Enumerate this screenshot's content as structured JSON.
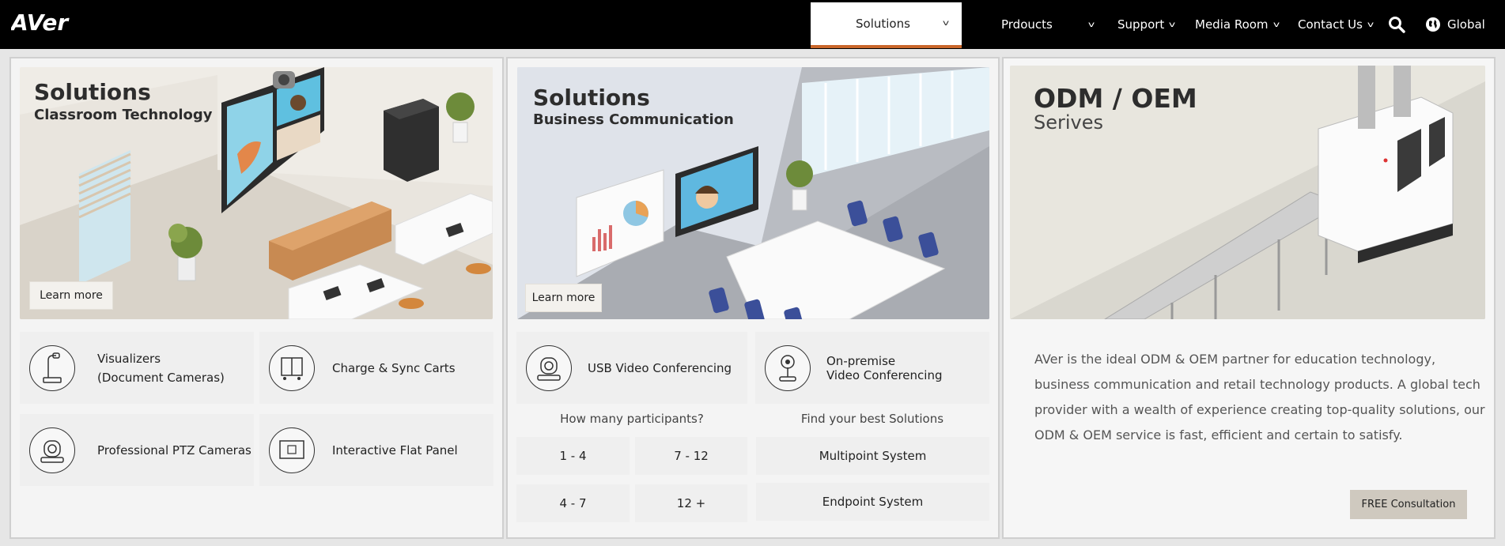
{
  "header": {
    "logo_text": "AVer",
    "nav": [
      {
        "label": "Solutions"
      },
      {
        "label": "Prdoucts"
      },
      {
        "label": "Support"
      },
      {
        "label": "Media Room"
      },
      {
        "label": "Contact Us"
      }
    ],
    "global_label": "Global",
    "search_icon": "search-icon",
    "globe_icon": "globe-icon"
  },
  "classroom": {
    "title": "Solutions",
    "subtitle": "Classroom Technology",
    "learn_more": "Learn more",
    "cards": [
      {
        "line1": "Visualizers",
        "line2": "(Document Cameras)",
        "icon": "document-camera-icon"
      },
      {
        "line1": "Charge & Sync Carts",
        "line2": "",
        "icon": "cart-icon"
      },
      {
        "line1": "Professional PTZ Cameras",
        "line2": "",
        "icon": "ptz-camera-icon"
      },
      {
        "line1": "Interactive Flat Panel",
        "line2": "",
        "icon": "flat-panel-icon"
      }
    ]
  },
  "business": {
    "title": "Solutions",
    "subtitle": "Business Communication",
    "learn_more": "Learn more",
    "cards": [
      {
        "line1": "USB Video Conferencing",
        "line2": "",
        "icon": "usb-camera-icon"
      },
      {
        "line1": "On-premise",
        "line2": "Video Conferencing",
        "icon": "conference-camera-icon"
      }
    ],
    "participants_question": "How many participants?",
    "solutions_question": "Find your best Solutions",
    "participant_options": [
      "1 - 4",
      "7 - 12",
      "4 - 7",
      "12 +"
    ],
    "solution_options": [
      "Multipoint System",
      "Endpoint System"
    ]
  },
  "oem": {
    "title": "ODM / OEM",
    "subtitle": "Serives",
    "description": "AVer is the ideal ODM & OEM partner for education technology, business communication and retail technology products. A global tech provider with a wealth of experience creating top-quality solutions, our ODM & OEM service is fast, efficient and certain to satisfy.",
    "cta": "FREE Consultation"
  },
  "colors": {
    "topbar": "#000000",
    "accent": "#c9662a",
    "cta_bg": "#cfc9bf"
  }
}
